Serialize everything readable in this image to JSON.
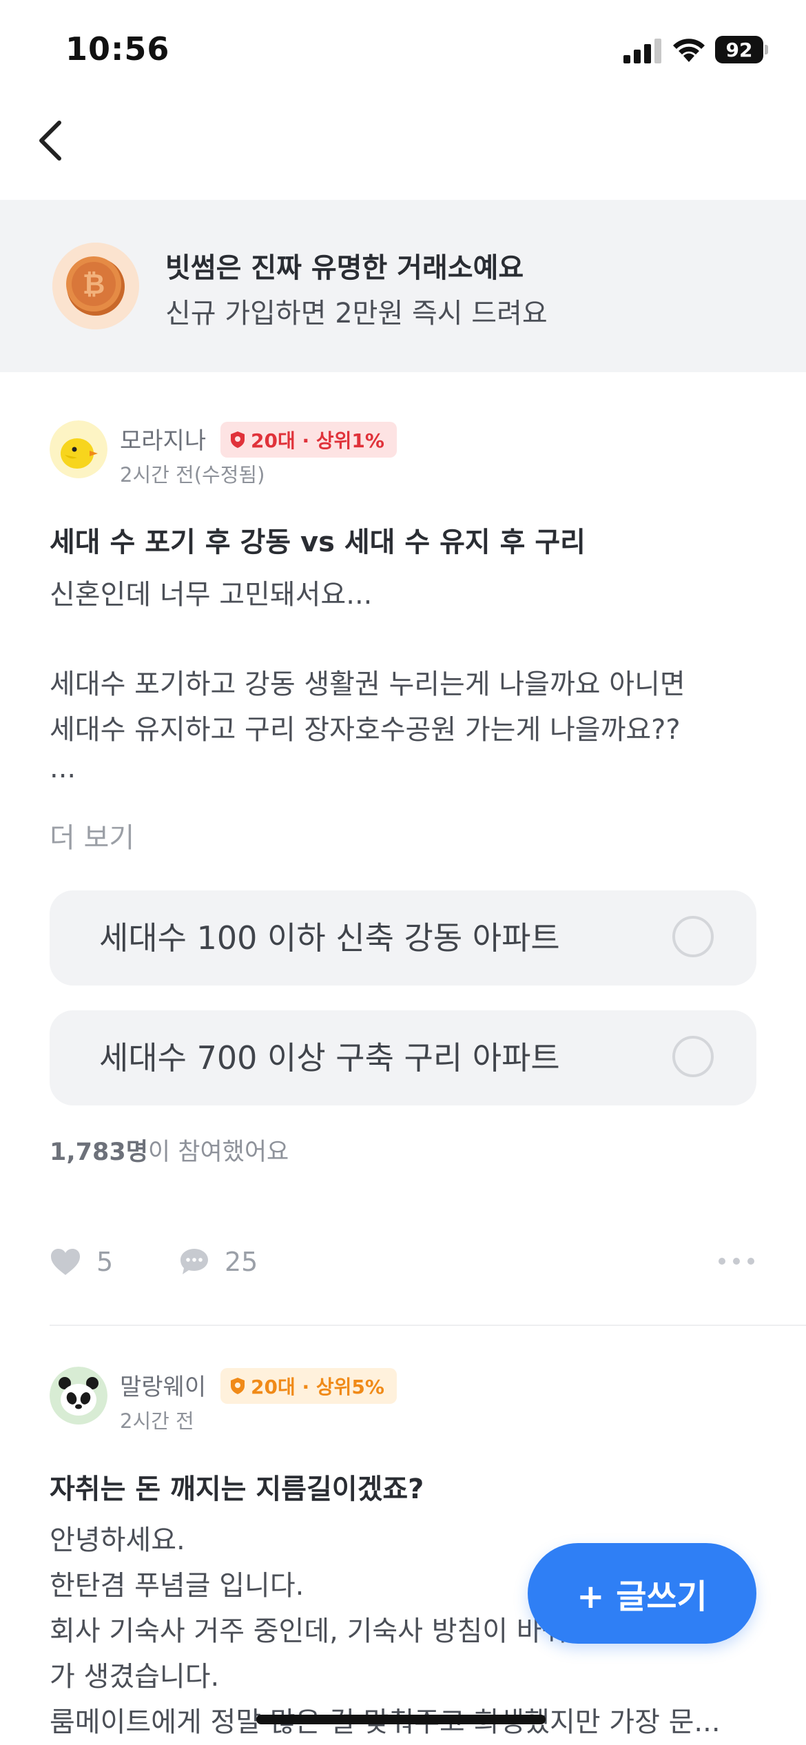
{
  "status_bar": {
    "time": "10:56",
    "battery": "92",
    "icons": [
      "signal-icon",
      "wifi-icon",
      "battery-icon"
    ]
  },
  "nav": {
    "back_icon": "chevron-left-icon"
  },
  "banner": {
    "title": "빗썸은 진짜 유명한 거래소예요",
    "subtitle": "신규 가입하면 2만원 즉시 드려요",
    "icon": "bitcoin-coin-icon"
  },
  "posts": [
    {
      "author": "모라지나",
      "badge": "20대 · 상위1%",
      "time": "2시간 전(수정됨)",
      "title": "세대 수 포기 후 강동 vs 세대 수 유지 후 구리",
      "body_lines": [
        "신혼인데 너무 고민돼서요...",
        "",
        "세대수 포기하고 강동 생활권 누리는게 나을까요 아니면",
        "세대수 유지하고 구리 장자호수공원 가는게 나을까요??",
        "..."
      ],
      "more": "더 보기",
      "poll": {
        "options": [
          "세대수 100 이하 신축 강동 아파트",
          "세대수 700 이상 구축 구리 아파트"
        ],
        "participants_count": "1,783명",
        "participants_suffix": "이 참여했어요"
      },
      "likes": "5",
      "comments": "25"
    },
    {
      "author": "말랑웨이",
      "badge": "20대 · 상위5%",
      "time": "2시간 전",
      "title": "자취는 돈 깨지는 지름길이겠죠?",
      "body_lines": [
        "안녕하세요.",
        "한탄겸 푸념글 입니다.",
        "회사 기숙사 거주 중인데, 기숙사 방침이 바뀌어서 룸메이트",
        "가 생겼습니다.",
        "룸메이트에게 정말 많은 걸 맞춰주고 희생했지만 가장 문..."
      ]
    }
  ],
  "fab": {
    "label": "+ 글쓰기"
  },
  "colors": {
    "accent": "#2f7ff5",
    "badge_red_bg": "#fde3e3",
    "badge_red_text": "#e0323a",
    "badge_orange_bg": "#fff1dc",
    "badge_orange_text": "#f08a18"
  }
}
